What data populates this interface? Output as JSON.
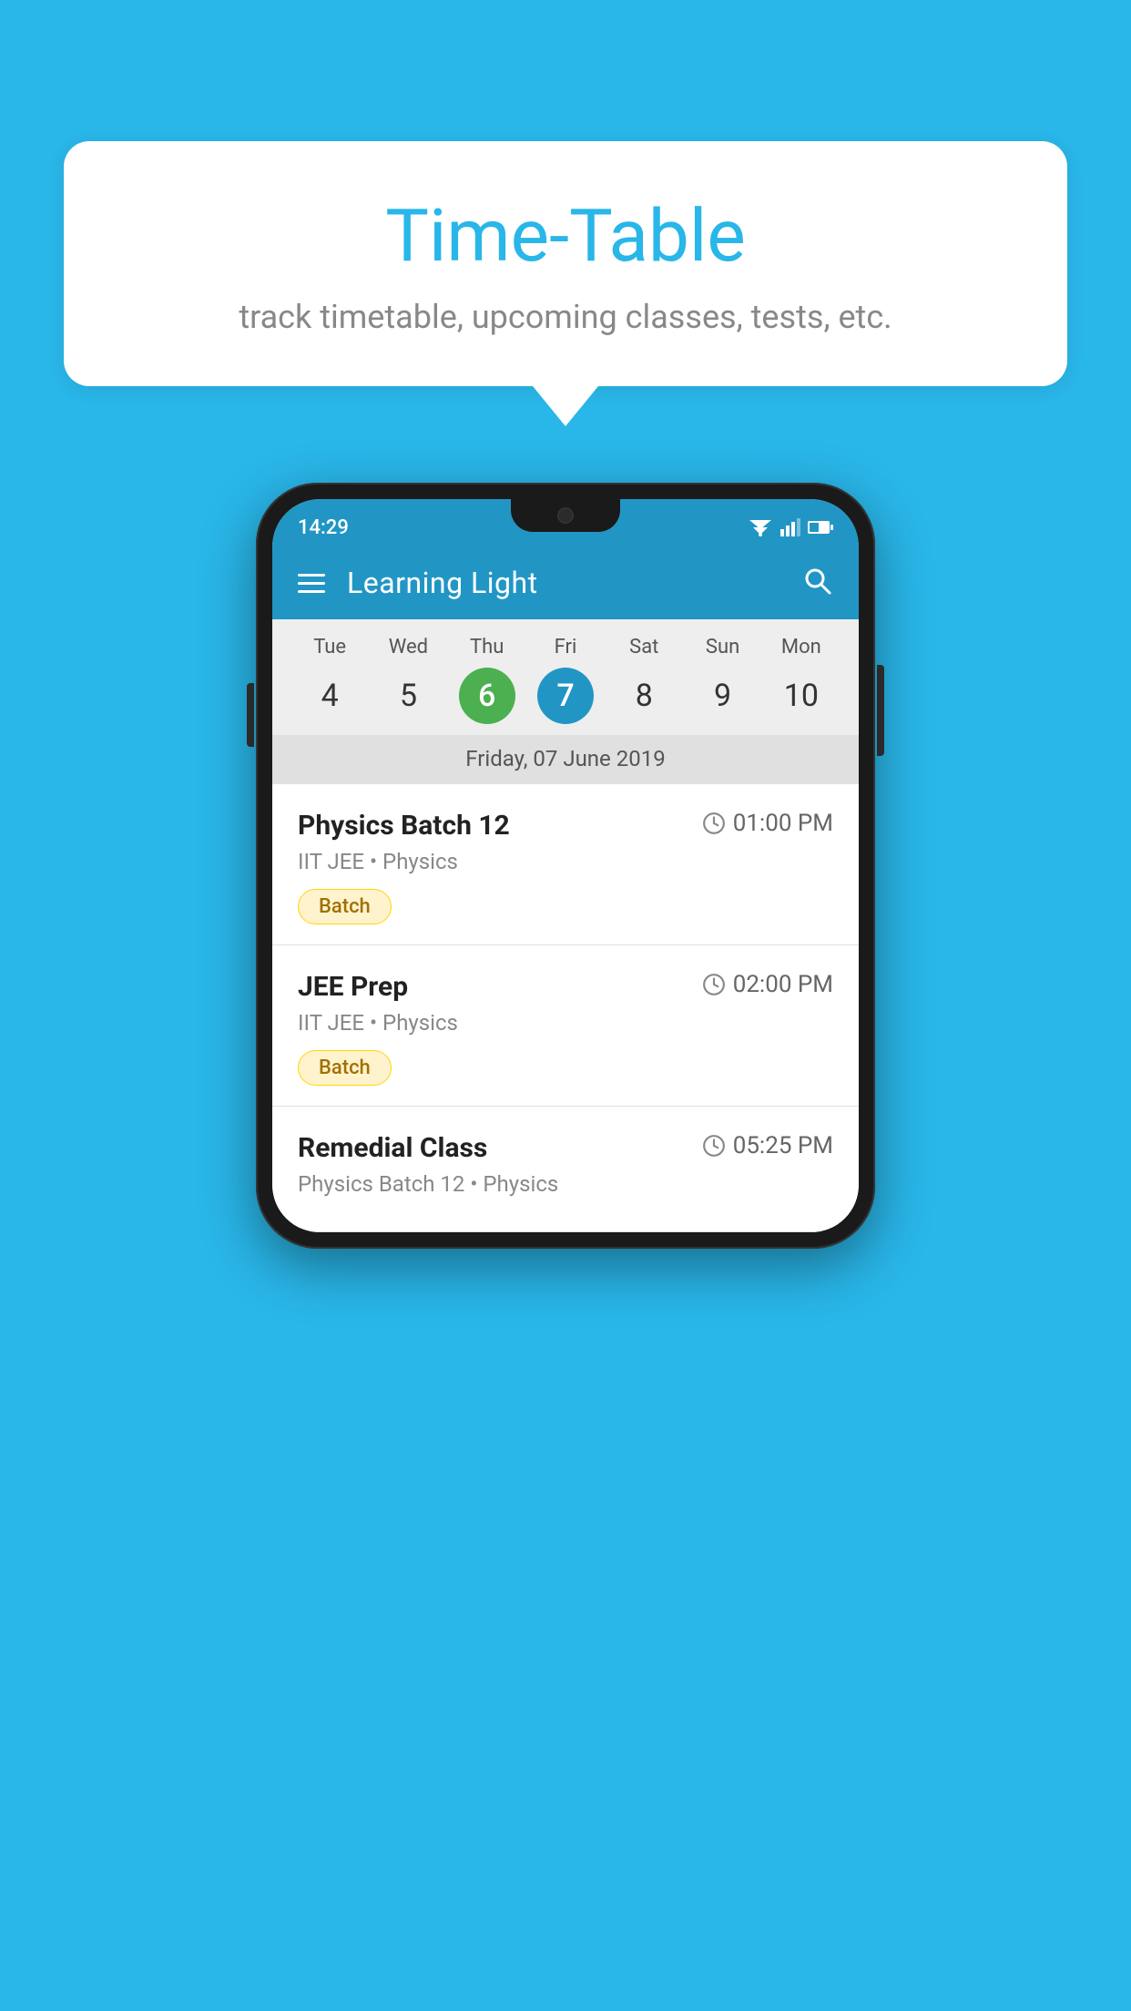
{
  "background_color": "#29b6e8",
  "speech_bubble": {
    "title": "Time-Table",
    "subtitle": "track timetable, upcoming classes, tests, etc."
  },
  "phone": {
    "status_bar": {
      "time": "14:29"
    },
    "app_bar": {
      "title": "Learning Light"
    },
    "calendar": {
      "days": [
        {
          "name": "Tue",
          "number": "4",
          "state": "normal"
        },
        {
          "name": "Wed",
          "number": "5",
          "state": "normal"
        },
        {
          "name": "Thu",
          "number": "6",
          "state": "today"
        },
        {
          "name": "Fri",
          "number": "7",
          "state": "selected"
        },
        {
          "name": "Sat",
          "number": "8",
          "state": "normal"
        },
        {
          "name": "Sun",
          "number": "9",
          "state": "normal"
        },
        {
          "name": "Mon",
          "number": "10",
          "state": "normal"
        }
      ],
      "selected_date_label": "Friday, 07 June 2019"
    },
    "schedule_items": [
      {
        "title": "Physics Batch 12",
        "time": "01:00 PM",
        "subtitle": "IIT JEE • Physics",
        "tag": "Batch"
      },
      {
        "title": "JEE Prep",
        "time": "02:00 PM",
        "subtitle": "IIT JEE • Physics",
        "tag": "Batch"
      },
      {
        "title": "Remedial Class",
        "time": "05:25 PM",
        "subtitle": "Physics Batch 12 • Physics",
        "tag": null
      }
    ]
  }
}
